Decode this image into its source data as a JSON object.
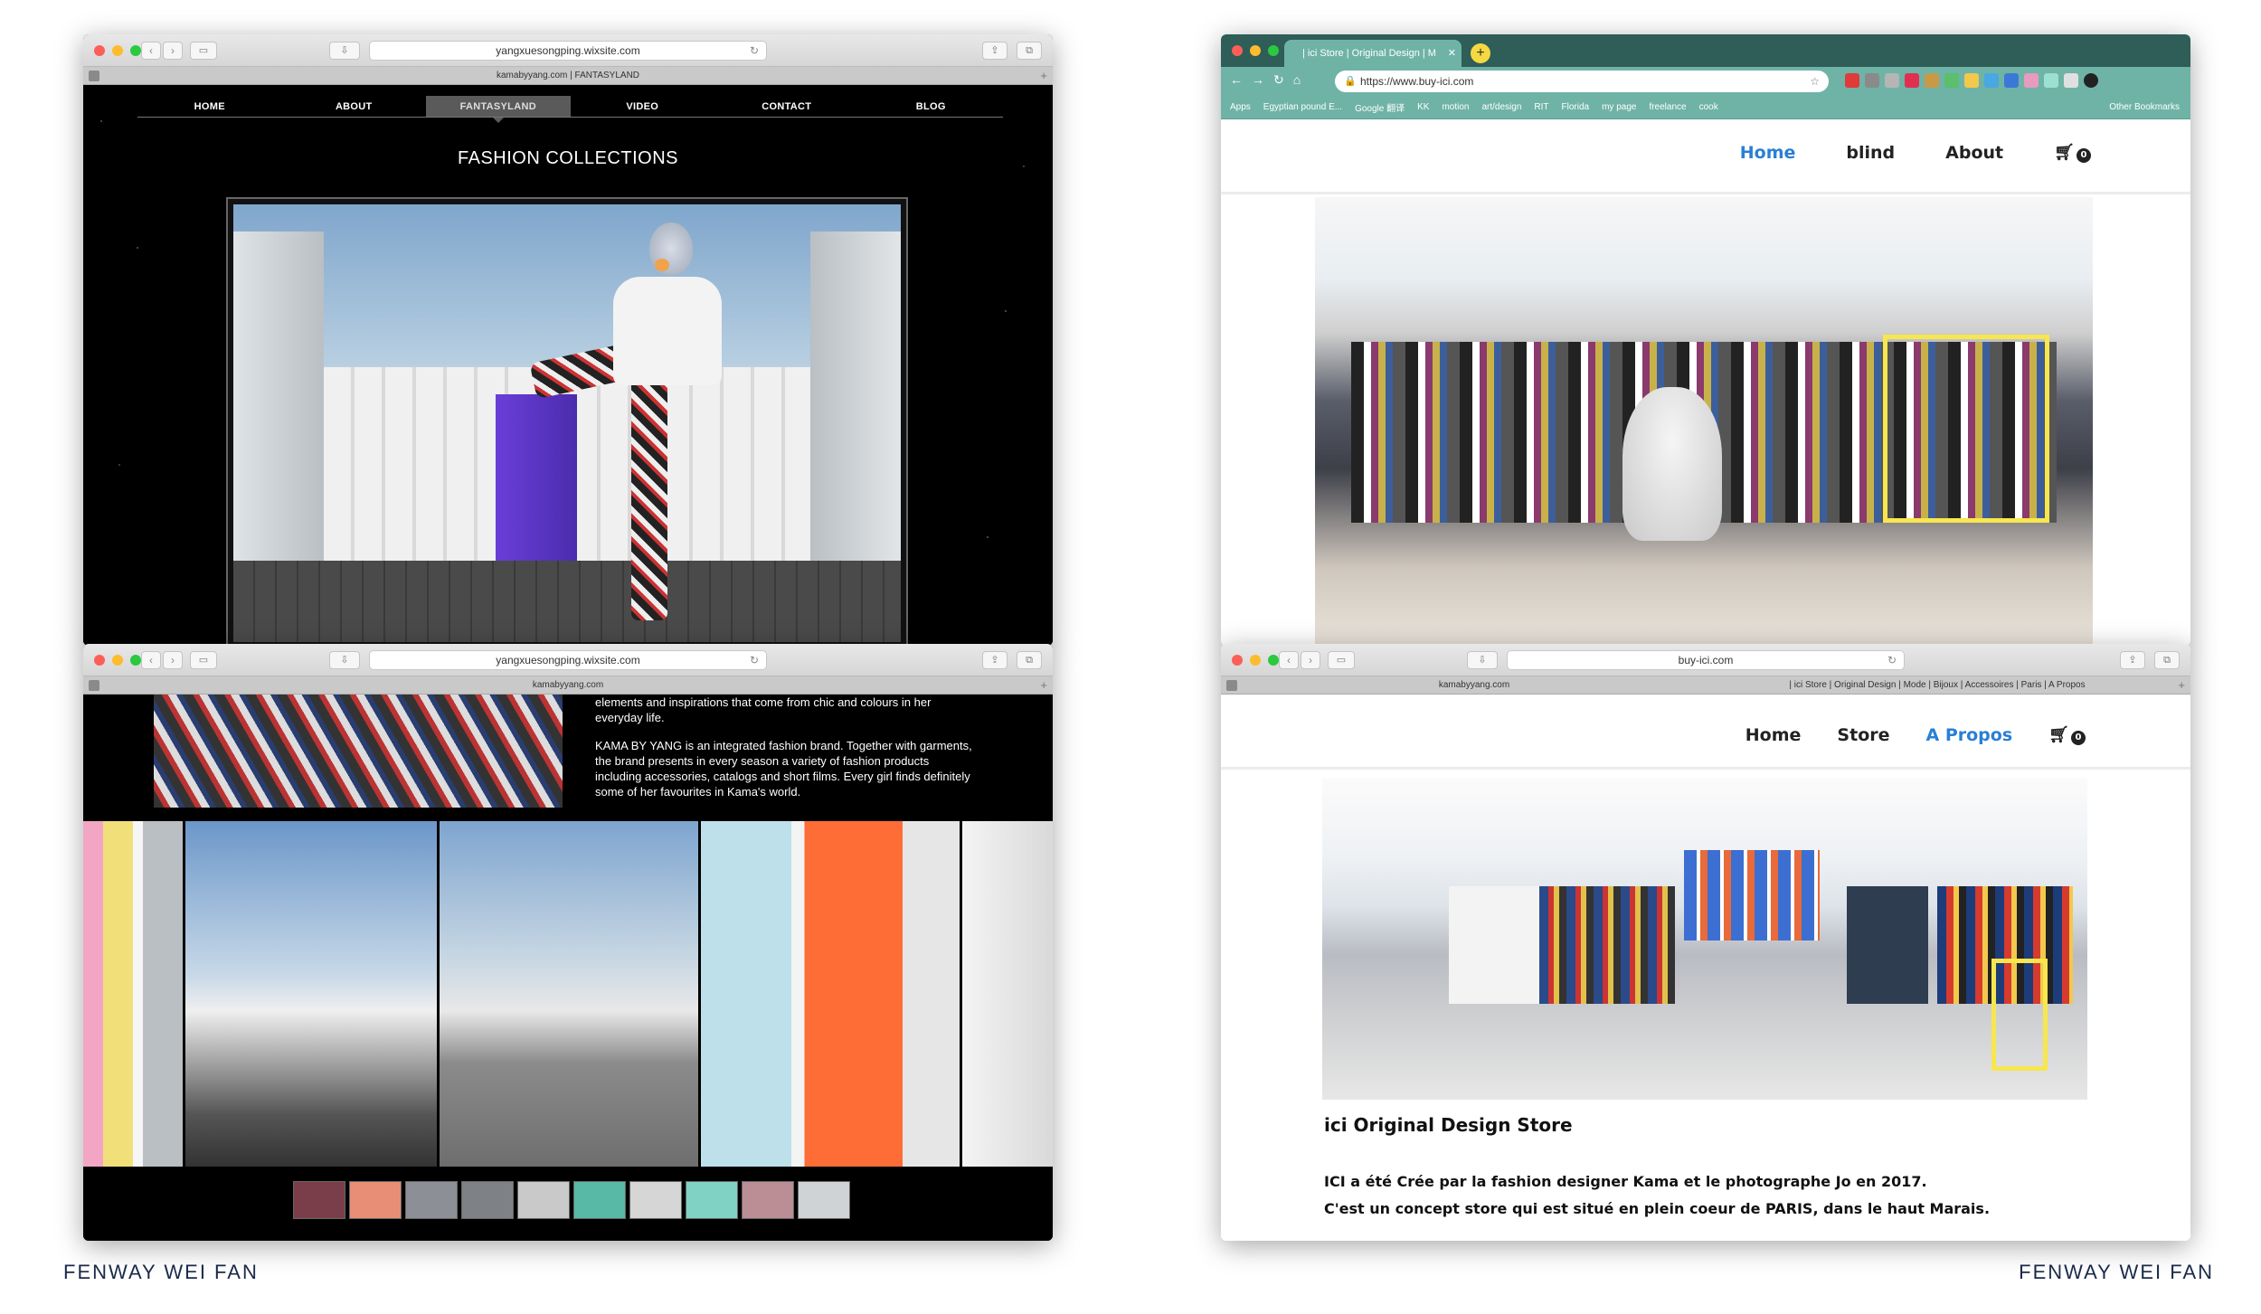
{
  "w1": {
    "url": "yangxuesongping.wixsite.com",
    "tab": "kamabyyang.com | FANTASYLAND",
    "nav": [
      "HOME",
      "ABOUT",
      "FANTASYLAND",
      "VIDEO",
      "CONTACT",
      "BLOG"
    ],
    "active_nav": "FANTASYLAND",
    "heading": "FASHION COLLECTIONS"
  },
  "w2": {
    "url": "yangxuesongping.wixsite.com",
    "tab": "kamabyyang.com",
    "para1": "elements and inspirations that come from chic and colours in her everyday life.",
    "para2": "KAMA BY YANG is an integrated fashion brand. Together with garments, the brand presents in every season a variety of fashion products including accessories, catalogs and short films. Every girl finds definitely some of her favourites in Kama's world."
  },
  "w3": {
    "tab_title": "| ici Store | Original Design | M",
    "url": "https://www.buy-ici.com",
    "bookmarks": [
      "Apps",
      "Egyptian pound E...",
      "Google 翻译",
      "KK",
      "motion",
      "art/design",
      "RIT",
      "Florida",
      "my page",
      "freelance",
      "cook"
    ],
    "other_bookmarks": "Other Bookmarks",
    "nav": [
      "Home",
      "blind",
      "About"
    ],
    "cart_count": "0"
  },
  "w4": {
    "url": "buy-ici.com",
    "tab_left": "kamabyyang.com",
    "tab_right": "| ici Store | Original Design | Mode | Bijoux | Accessoires | Paris | A Propos",
    "nav": [
      "Home",
      "Store",
      "A Propos"
    ],
    "cart_count": "0",
    "store_title": "ici Original Design Store",
    "line1": "ICI a été Crée par la fashion designer Kama et le photographe Jo en 2017.",
    "line2": "C'est un concept store qui est situé en plein coeur de PARIS, dans le haut Marais."
  },
  "credit": "FENWAY WEI FAN",
  "colors": {
    "highlight": "#f8e64f",
    "link_active": "#2a7fd4",
    "chrome_teal": "#6fb3a7"
  }
}
